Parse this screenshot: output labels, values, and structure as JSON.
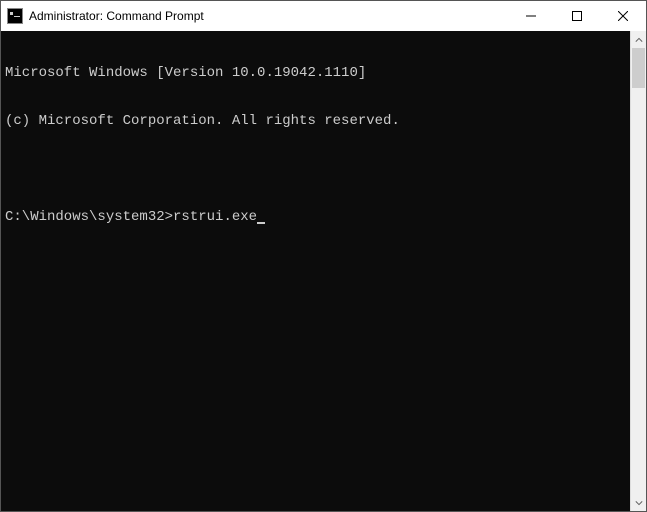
{
  "window": {
    "title": "Administrator: Command Prompt"
  },
  "terminal": {
    "line1": "Microsoft Windows [Version 10.0.19042.1110]",
    "line2": "(c) Microsoft Corporation. All rights reserved.",
    "prompt": "C:\\Windows\\system32>",
    "command": "rstrui.exe"
  }
}
